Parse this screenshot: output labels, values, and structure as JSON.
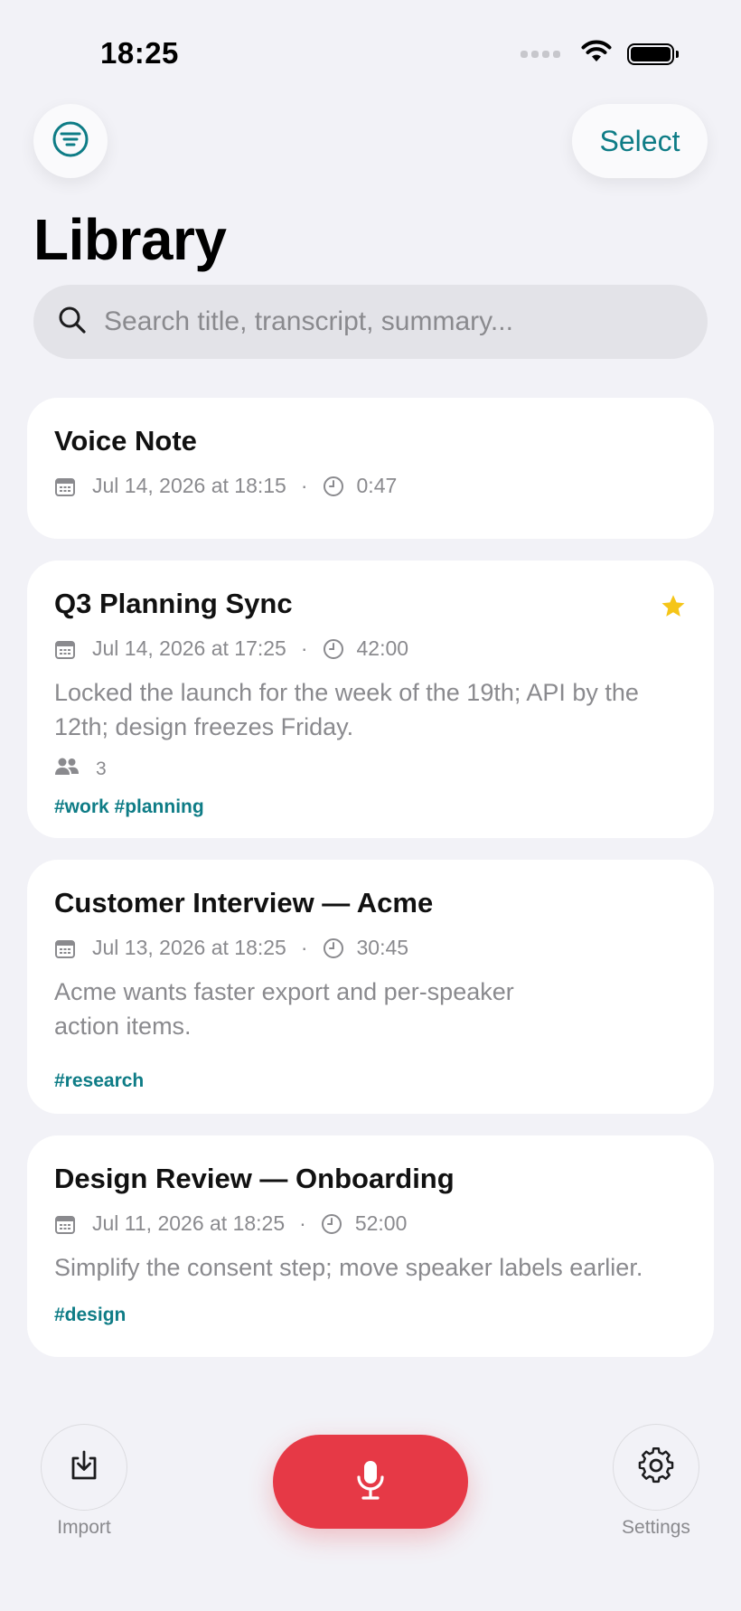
{
  "status_bar": {
    "time": "18:25"
  },
  "header": {
    "select_label": "Select",
    "title": "Library"
  },
  "search": {
    "placeholder": "Search title, transcript, summary..."
  },
  "recordings": [
    {
      "title": "Voice Note",
      "date": "Jul 14, 2026 at 18:15",
      "separator": "·",
      "duration": "0:47",
      "starred": false
    },
    {
      "title": "Q3 Planning Sync",
      "date": "Jul 14, 2026 at 17:25",
      "separator": "·",
      "duration": "42:00",
      "summary": "Locked the launch for the week of the 19th; API by the 12th; design freezes Friday.",
      "participants": "3",
      "tags": "#work #planning",
      "starred": true
    },
    {
      "title": "Customer Interview — Acme",
      "date": "Jul 13, 2026 at 18:25",
      "separator": "·",
      "duration": "30:45",
      "summary": "Acme wants faster export and per-speaker action items.",
      "tags": "#research",
      "starred": false
    },
    {
      "title": "Design Review — Onboarding",
      "date": "Jul 11, 2026 at 18:25",
      "separator": "·",
      "duration": "52:00",
      "summary": "Simplify the consent step; move speaker labels earlier.",
      "tags": "#design",
      "starred": false
    }
  ],
  "bottom_bar": {
    "import_label": "Import",
    "settings_label": "Settings"
  },
  "icons": {
    "filter": "filter-icon",
    "search": "search-icon",
    "calendar": "calendar-icon",
    "clock": "clock-icon",
    "people": "people-icon",
    "star": "star-icon",
    "import": "import-icon",
    "microphone": "microphone-icon",
    "settings": "gear-icon"
  },
  "colors": {
    "accent": "#0e7c86",
    "record": "#e63946",
    "star": "#f5c518",
    "background": "#f2f2f7"
  }
}
